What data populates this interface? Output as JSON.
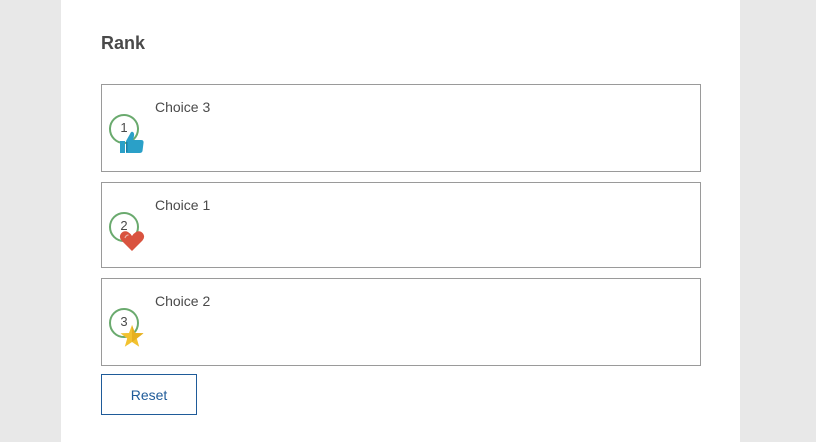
{
  "question": {
    "title": "Rank"
  },
  "items": [
    {
      "rank": "1",
      "label": "Choice 3",
      "icon": "thumbs-up-icon",
      "icon_color": "#2aa0c8"
    },
    {
      "rank": "2",
      "label": "Choice 1",
      "icon": "heart-icon",
      "icon_color": "#d9533f"
    },
    {
      "rank": "3",
      "label": "Choice 2",
      "icon": "star-icon",
      "icon_color": "#f2c230"
    }
  ],
  "reset_label": "Reset",
  "colors": {
    "accent": "#1f5b99",
    "rank_circle": "#6aaa6e",
    "border": "#9a9a9a",
    "background": "#e8e8e8"
  }
}
